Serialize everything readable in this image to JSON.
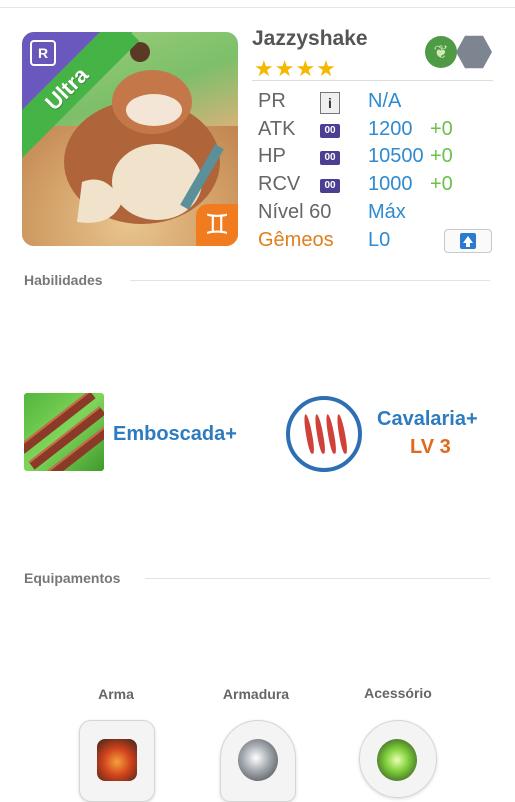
{
  "character": {
    "name": "Jazzyshake",
    "stars": "★★★★",
    "rarity_label": "Ultra",
    "rarity_badge": "R",
    "zodiac_symbol": "♊",
    "elements": [
      "leaf-icon",
      "rock-icon"
    ]
  },
  "stats": {
    "pr": {
      "label": "PR",
      "info": "i",
      "value": "N/A"
    },
    "atk": {
      "label": "ATK",
      "badge": "00",
      "value": "1200",
      "bonus": "+0"
    },
    "hp": {
      "label": "HP",
      "badge": "00",
      "value": "10500",
      "bonus": "+0"
    },
    "rcv": {
      "label": "RCV",
      "badge": "00",
      "value": "1000",
      "bonus": "+0"
    },
    "level": {
      "label": "Nível 60",
      "value": "Máx"
    },
    "sign": {
      "label": "Gêmeos",
      "value": "L0"
    }
  },
  "sections": {
    "skills": "Habilidades",
    "equipment": "Equipamentos"
  },
  "skills": [
    {
      "name": "Emboscada+"
    },
    {
      "name": "Cavalaria+",
      "level": "LV 3"
    }
  ],
  "equipment": {
    "weapon": "Arma",
    "armor": "Armadura",
    "accessory": "Acessório"
  },
  "colors": {
    "accent_blue": "#2e8bcf",
    "bonus_green": "#6cc04a",
    "orange": "#e07f1c",
    "ultra_green": "#46b347",
    "rarity_purple": "#6b58bf"
  }
}
